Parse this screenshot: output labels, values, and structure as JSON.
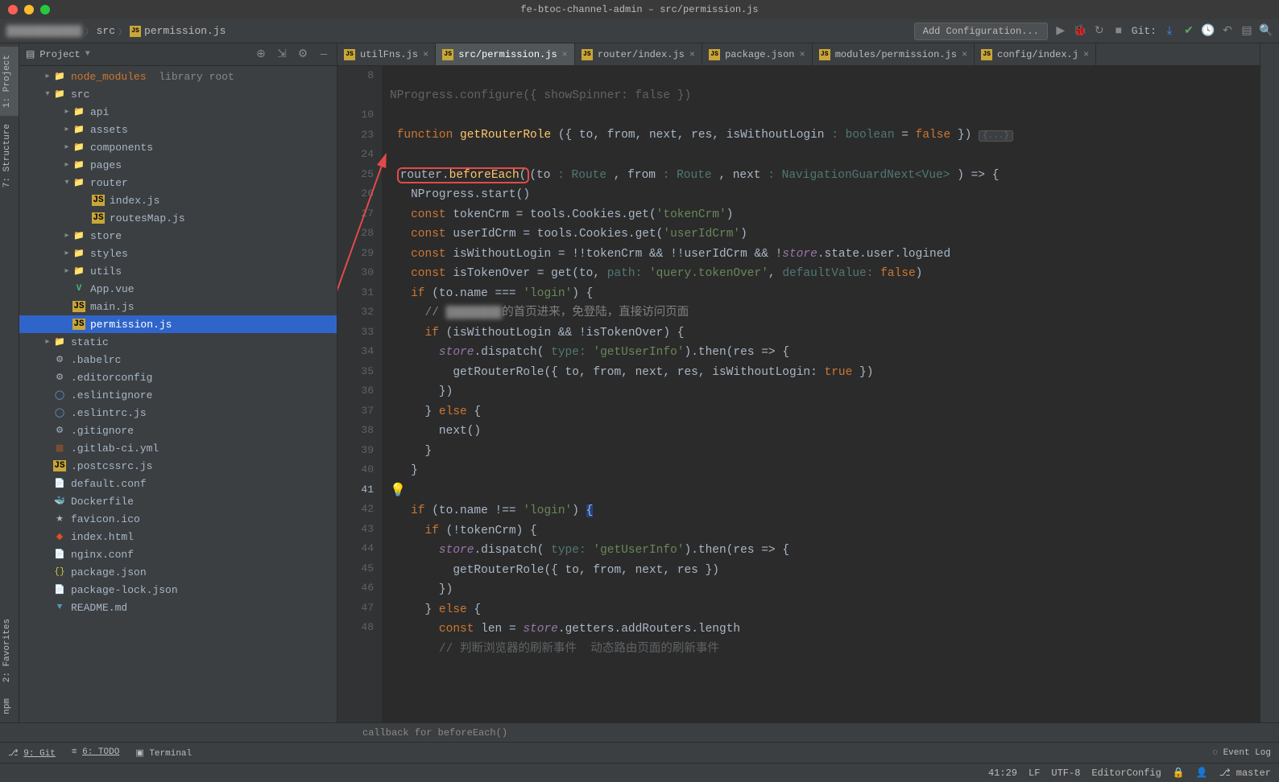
{
  "window_title": "fe-btoc-channel-admin – src/permission.js",
  "breadcrumb": {
    "folder": "src",
    "file": "permission.js"
  },
  "toolbar": {
    "add_config": "Add Configuration...",
    "git_label": "Git:"
  },
  "sidebar_tabs": {
    "project": "1: Project",
    "structure": "7: Structure",
    "favorites": "2: Favorites",
    "npm": "npm"
  },
  "project_panel": {
    "title": "Project"
  },
  "tree": {
    "node_modules": "node_modules",
    "node_modules_hint": "library root",
    "src": "src",
    "api": "api",
    "assets": "assets",
    "components": "components",
    "pages": "pages",
    "router": "router",
    "router_index": "index.js",
    "router_routes": "routesMap.js",
    "store": "store",
    "styles": "styles",
    "utils": "utils",
    "app_vue": "App.vue",
    "main_js": "main.js",
    "permission_js": "permission.js",
    "static": "static",
    "babelrc": ".babelrc",
    "editorconfig": ".editorconfig",
    "eslintignore": ".eslintignore",
    "eslintrc": ".eslintrc.js",
    "gitignore": ".gitignore",
    "gitlab": ".gitlab-ci.yml",
    "postcss": ".postcssrc.js",
    "default_conf": "default.conf",
    "dockerfile": "Dockerfile",
    "favicon": "favicon.ico",
    "index_html": "index.html",
    "nginx": "nginx.conf",
    "package_json": "package.json",
    "package_lock": "package-lock.json",
    "readme": "README.md"
  },
  "tabs": [
    {
      "label": "utilFns.js",
      "active": false
    },
    {
      "label": "src/permission.js",
      "active": true
    },
    {
      "label": "router/index.js",
      "active": false
    },
    {
      "label": "package.json",
      "active": false
    },
    {
      "label": "modules/permission.js",
      "active": false
    },
    {
      "label": "config/index.j",
      "active": false
    }
  ],
  "line_numbers": [
    "8",
    "",
    "10",
    "23",
    "24",
    "25",
    "26",
    "27",
    "28",
    "29",
    "30",
    "31",
    "32",
    "33",
    "34",
    "35",
    "36",
    "37",
    "38",
    "39",
    "40",
    "41",
    "42",
    "43",
    "44",
    "45",
    "46",
    "47",
    "48"
  ],
  "current_line": "41",
  "code": {
    "l8": "NProgress.configure({ showSpinner: false })",
    "l10_a": "function",
    "l10_b": "getRouterRole",
    "l10_c": " ({ to, from, next, res, isWithoutLogin ",
    "l10_d": ": boolean",
    "l10_e": " = ",
    "l10_f": "false",
    "l10_g": " }) ",
    "l10_fold": "{...}",
    "l24_a": "router.",
    "l24_b": "beforeEach",
    "l24_c": "(",
    "l24_d": "(to ",
    "l24_e": ": Route",
    "l24_f": " , from ",
    "l24_g": ": Route",
    "l24_h": " , next ",
    "l24_i": ": NavigationGuardNext<Vue>",
    "l24_j": " ) => {",
    "l25": "NProgress.start()",
    "l26_a": "const",
    "l26_b": " tokenCrm = tools.Cookies.get(",
    "l26_c": "'tokenCrm'",
    "l26_d": ")",
    "l27_a": "const",
    "l27_b": " userIdCrm = tools.Cookies.get(",
    "l27_c": "'userIdCrm'",
    "l27_d": ")",
    "l28_a": "const",
    "l28_b": " isWithoutLogin = !!tokenCrm && !!userIdCrm && !",
    "l28_c": "store",
    "l28_d": ".state.user.logined",
    "l29_a": "const",
    "l29_b": " isTokenOver = get(to, ",
    "l29_c": "path:",
    "l29_d": " 'query.tokenOver'",
    "l29_e": ", ",
    "l29_f": "defaultValue:",
    "l29_g": " false",
    "l29_h": ")",
    "l30_a": "if",
    "l30_b": " (to.name === ",
    "l30_c": "'login'",
    "l30_d": ") {",
    "l31_a": "// ",
    "l31_b": "的首页进来，免登陆，直接访问页面",
    "l32_a": "if",
    "l32_b": " (isWithoutLogin && !isTokenOver) {",
    "l33_a": "store",
    "l33_b": ".dispatch( ",
    "l33_c": "type:",
    "l33_d": " 'getUserInfo'",
    "l33_e": ").then(res => {",
    "l34_a": "getRouterRole({ to, from, next, res, isWithoutLogin: ",
    "l34_b": "true",
    "l34_c": " })",
    "l35": "})",
    "l36_a": "} ",
    "l36_b": "else",
    "l36_c": " {",
    "l37": "next()",
    "l38": "}",
    "l39": "}",
    "l41_a": "if",
    "l41_b": " (to.name !== ",
    "l41_c": "'login'",
    "l41_d": ") ",
    "l41_e": "{",
    "l42_a": "if",
    "l42_b": " (!tokenCrm) {",
    "l43_a": "store",
    "l43_b": ".dispatch( ",
    "l43_c": "type:",
    "l43_d": " 'getUserInfo'",
    "l43_e": ").then(res => {",
    "l44": "getRouterRole({ to, from, next, res })",
    "l45": "})",
    "l46_a": "} ",
    "l46_b": "else",
    "l46_c": " {",
    "l47_a": "const",
    "l47_b": " len = ",
    "l47_c": "store",
    "l47_d": ".getters.addRouters.length",
    "l48": "// 判断浏览器的刷新事件  动态路由页面的刷新事件"
  },
  "footer_breadcrumb": "callback for beforeEach()",
  "bottom": {
    "git": "9: Git",
    "todo": "6: TODO",
    "terminal": "Terminal",
    "event_log": "Event Log"
  },
  "status": {
    "pos": "41:29",
    "lf": "LF",
    "enc": "UTF-8",
    "cfg": "EditorConfig",
    "branch": "master"
  }
}
